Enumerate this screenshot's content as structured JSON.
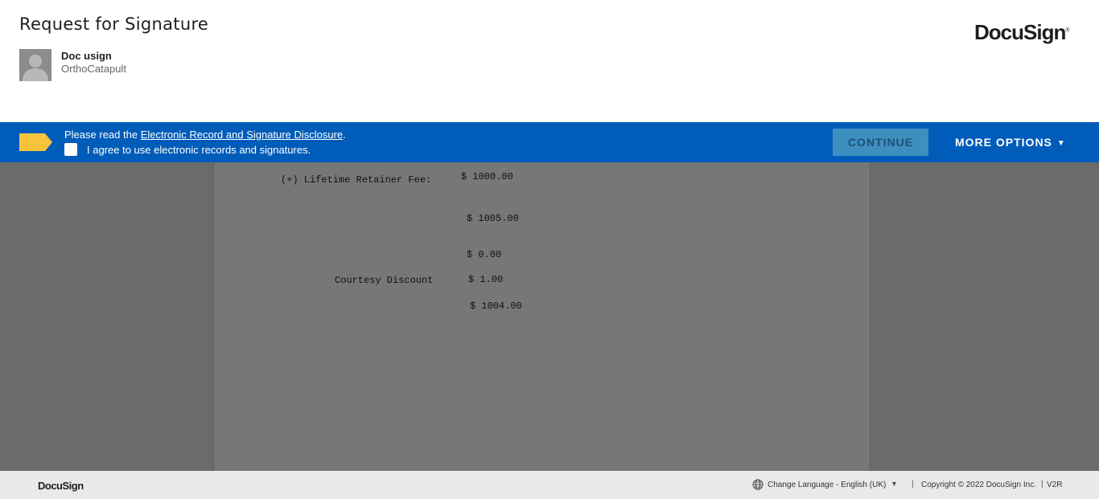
{
  "header": {
    "title": "Request for Signature",
    "sender_name": "Doc usign",
    "sender_org": "OrthoCatapult",
    "logo": "DocuSign",
    "logo_mark": "®"
  },
  "banner": {
    "prefix": "Please read the ",
    "disclosure_link": "Electronic Record and Signature Disclosure",
    "suffix": ".",
    "agree_label": "I agree to use electronic records and signatures.",
    "agree_checked": false,
    "continue_label": "CONTINUE",
    "more_options_label": "MORE OPTIONS",
    "more_options_caret": "▼",
    "banner_color": "#005cb9"
  },
  "document": {
    "lifetime_fee_label": "(+) Lifetime Retainer Fee:",
    "lifetime_fee_value": "$ 1000.00",
    "subtotal_value": "$ 1005.00",
    "zero_value": "$ 0.00",
    "courtesy_label": "Courtesy Discount",
    "courtesy_value": "$ 1.00",
    "total_value": "$ 1004.00"
  },
  "footer": {
    "logo": "DocuSign",
    "language": "Change Language - English (UK)",
    "language_caret": "▼",
    "separator": "|",
    "copyright": "Copyright © 2022 DocuSign Inc.",
    "version": "V2R"
  }
}
